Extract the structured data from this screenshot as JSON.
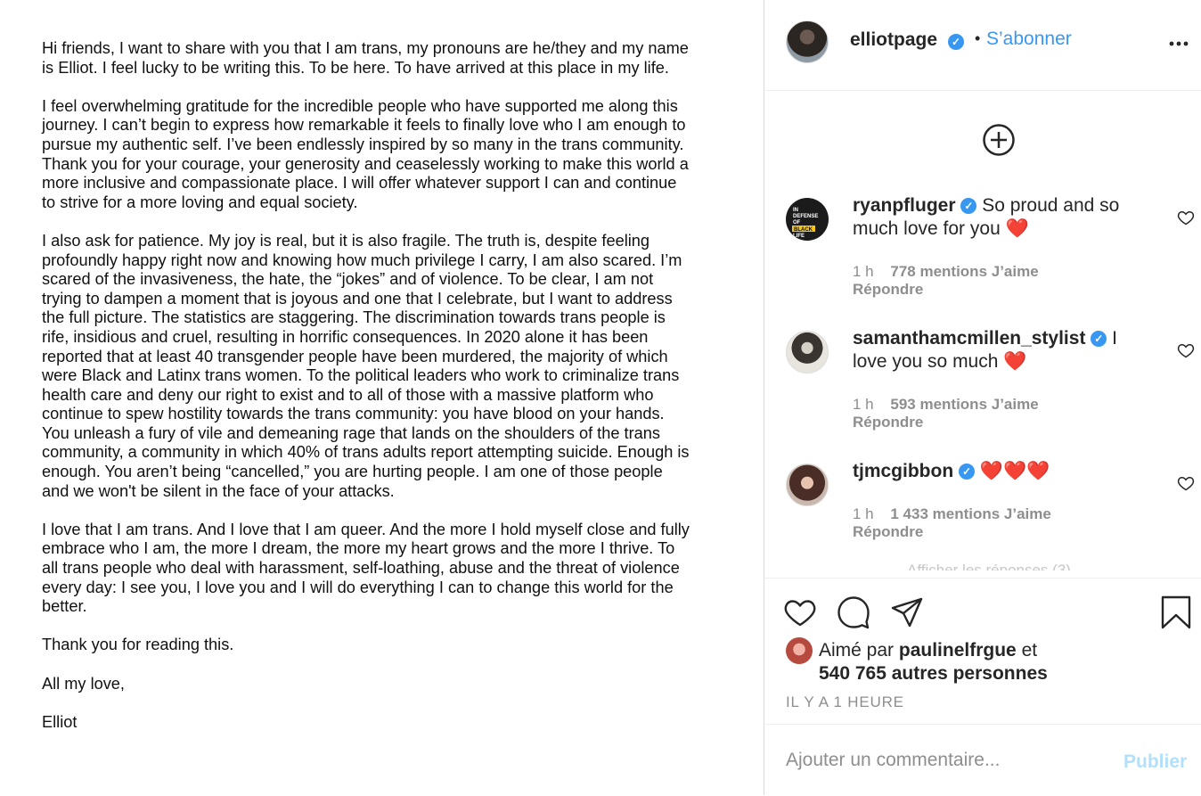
{
  "letter": {
    "paragraphs": [
      "Hi friends, I want to share with you that I am trans, my pronouns are he/they and my name is Elliot. I feel lucky to be writing this. To be here. To have arrived at this place in my life.",
      "I feel overwhelming gratitude for the incredible people who have supported me along this journey. I can’t begin to express how remarkable it feels to finally love who I am enough to pursue my authentic self. I’ve been endlessly inspired by so many in the trans community. Thank you for your courage, your generosity and ceaselessly working to make this world a more inclusive and compassionate place. I will offer whatever support I can and continue to strive for a more loving and equal society.",
      "I also ask for patience. My joy is real, but it is also fragile. The truth is, despite feeling profoundly happy right now and knowing how much privilege I carry, I am also scared. I’m scared of the invasiveness, the hate, the “jokes” and of violence. To be clear, I am not trying to dampen a moment that is joyous and one that I celebrate, but I want to address the full picture. The statistics are staggering. The discrimination towards trans people is rife, insidious and cruel, resulting in horrific consequences. In 2020 alone it has been reported that at least 40 transgender people have been murdered, the majority of which were Black and Latinx trans women. To the political leaders who work to criminalize trans health care and deny our right to exist and to all of those with a massive platform who continue to spew hostility towards the trans community: you have blood on your hands. You unleash a fury of vile and demeaning rage that lands on the shoulders of the trans community, a community in which 40% of trans adults report attempting suicide. Enough is enough. You aren’t being “cancelled,” you are hurting people. I am one of those people and we won't be silent in the face of your attacks.",
      "I love that I am trans. And I love that I am queer. And the more I hold myself close and fully embrace who I am, the more I dream, the more my heart grows and the more I thrive. To all trans people who deal with harassment, self-loathing, abuse and the threat of violence every day: I see you, I love you and I will do everything I can to change this world for the better.",
      "Thank you for reading this.",
      "All my love,",
      "Elliot"
    ]
  },
  "header": {
    "username": "elliotpage",
    "verified_mark": "✓",
    "separator": "•",
    "follow_label": "S’abonner"
  },
  "comments": [
    {
      "username": "ryanpfluger",
      "text": "So proud and so much love for you",
      "emoji": "❤️",
      "time": "1 h",
      "likes": "778 mentions J’aime",
      "reply": "Répondre",
      "avatar_text": "IN DEFENSE OF BLACK LIFE"
    },
    {
      "username": "samanthamcmillen_stylist",
      "text": "I love you so much",
      "emoji": "❤️",
      "time": "1 h",
      "likes": "593 mentions J’aime",
      "reply": "Répondre"
    },
    {
      "username": "tjmcgibbon",
      "text": "",
      "emoji": "❤️❤️❤️",
      "time": "1 h",
      "likes": "1 433 mentions J’aime",
      "reply": "Répondre"
    }
  ],
  "hidden_replies": "Afficher les réponses (3)",
  "likes": {
    "prefix": "Aimé par",
    "user": "paulinelfrgue",
    "middle": "et",
    "others": "540 765 autres personnes"
  },
  "timestamp": "IL Y A 1 HEURE",
  "comment_box": {
    "placeholder": "Ajouter un commentaire...",
    "publish_label": "Publier"
  },
  "colors": {
    "accent": "#3897f0",
    "heart": "#e0245e",
    "muted": "#8e8e8e",
    "publish_disabled": "#b2dffc"
  },
  "icons": [
    "more-icon",
    "add-circle-icon",
    "heart-icon",
    "comment-icon",
    "share-icon",
    "bookmark-icon"
  ]
}
